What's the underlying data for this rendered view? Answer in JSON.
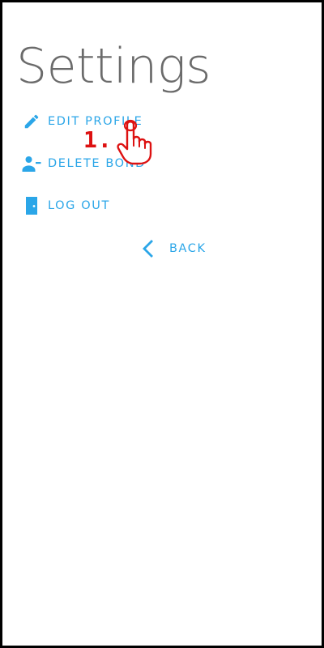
{
  "header": {
    "title": "Settings"
  },
  "menu": {
    "items": [
      {
        "label": "EDIT PROFILE",
        "icon": "pencil-icon"
      },
      {
        "label": "DELETE BOND",
        "icon": "person-remove-icon"
      },
      {
        "label": "LOG OUT",
        "icon": "door-icon"
      }
    ]
  },
  "back": {
    "label": "BACK",
    "icon": "chevron-left-icon"
  },
  "annotation": {
    "step": "1.",
    "pointer_icon": "hand-pointer-icon"
  },
  "colors": {
    "accent": "#2ba6e8",
    "title": "#6b6b6b",
    "annotation": "#dd1111",
    "border": "#000000"
  }
}
